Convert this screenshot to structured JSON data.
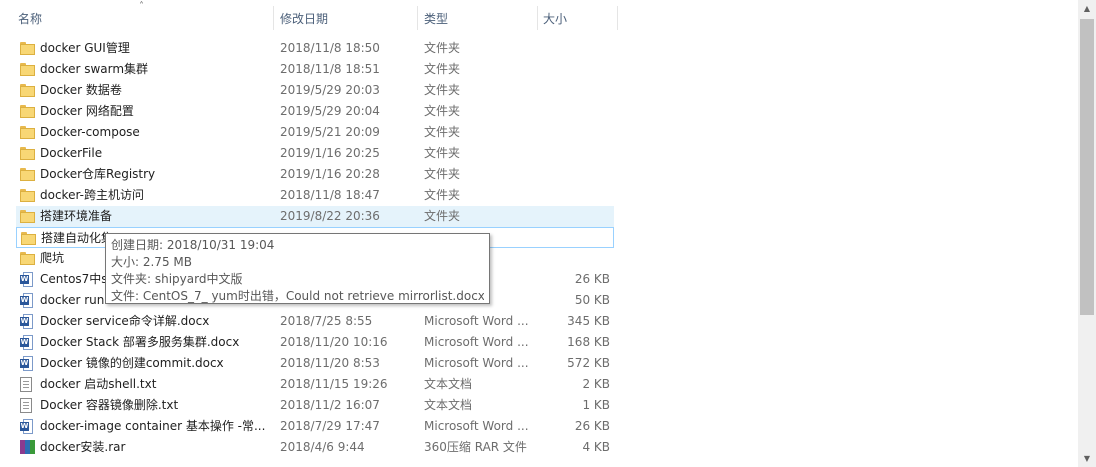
{
  "columns": {
    "name": "名称",
    "date": "修改日期",
    "type": "类型",
    "size": "大小"
  },
  "sort_indicator": "˄",
  "files": [
    {
      "name": "docker GUI管理",
      "date": "2018/11/8 18:50",
      "type": "文件夹",
      "size": "",
      "icon": "folder-icon"
    },
    {
      "name": "docker swarm集群",
      "date": "2018/11/8 18:51",
      "type": "文件夹",
      "size": "",
      "icon": "folder-icon"
    },
    {
      "name": "Docker 数据卷",
      "date": "2019/5/29 20:03",
      "type": "文件夹",
      "size": "",
      "icon": "folder-icon"
    },
    {
      "name": "Docker 网络配置",
      "date": "2019/5/29 20:04",
      "type": "文件夹",
      "size": "",
      "icon": "folder-icon"
    },
    {
      "name": "Docker-compose",
      "date": "2019/5/21 20:09",
      "type": "文件夹",
      "size": "",
      "icon": "folder-icon"
    },
    {
      "name": "DockerFile",
      "date": "2019/1/16 20:25",
      "type": "文件夹",
      "size": "",
      "icon": "folder-icon"
    },
    {
      "name": "Docker仓库Registry",
      "date": "2019/1/16 20:28",
      "type": "文件夹",
      "size": "",
      "icon": "folder-icon"
    },
    {
      "name": "docker-跨主机访问",
      "date": "2018/11/8 18:47",
      "type": "文件夹",
      "size": "",
      "icon": "folder-icon"
    },
    {
      "name": "搭建环境准备",
      "date": "2019/8/22 20:36",
      "type": "文件夹",
      "size": "",
      "icon": "folder-icon"
    },
    {
      "name": "搭建自动化集",
      "date": "",
      "type": "",
      "size": "",
      "icon": "folder-icon"
    },
    {
      "name": "爬坑",
      "date": "",
      "type": "",
      "size": "",
      "icon": "folder-icon"
    },
    {
      "name": "Centos7中s",
      "date": "",
      "type": "Word ...",
      "size": "26 KB",
      "icon": "word-doc-icon"
    },
    {
      "name": "docker run",
      "date": "",
      "type": "Word ...",
      "size": "50 KB",
      "icon": "word-doc-icon"
    },
    {
      "name": "Docker service命令详解.docx",
      "date": "2018/7/25 8:55",
      "type": "Microsoft Word ...",
      "size": "345 KB",
      "icon": "word-doc-icon"
    },
    {
      "name": "Docker Stack 部署多服务集群.docx",
      "date": "2018/11/20 10:16",
      "type": "Microsoft Word ...",
      "size": "168 KB",
      "icon": "word-doc-icon"
    },
    {
      "name": "Docker 镜像的创建commit.docx",
      "date": "2018/11/20 8:53",
      "type": "Microsoft Word ...",
      "size": "572 KB",
      "icon": "word-doc-icon"
    },
    {
      "name": "docker 启动shell.txt",
      "date": "2018/11/15 19:26",
      "type": "文本文档",
      "size": "2 KB",
      "icon": "text-file-icon"
    },
    {
      "name": "Docker 容器镜像删除.txt",
      "date": "2018/11/2 16:07",
      "type": "文本文档",
      "size": "1 KB",
      "icon": "text-file-icon"
    },
    {
      "name": "docker-image container 基本操作 -常...",
      "date": "2018/7/29 17:47",
      "type": "Microsoft Word ...",
      "size": "26 KB",
      "icon": "word-doc-icon"
    },
    {
      "name": "docker安装.rar",
      "date": "2018/4/6 9:44",
      "type": "360压缩 RAR 文件",
      "size": "4 KB",
      "icon": "rar-archive-icon"
    }
  ],
  "tooltip": {
    "created": "创建日期: 2018/10/31 19:04",
    "size": "大小: 2.75 MB",
    "folders": "文件夹: shipyard中文版",
    "files": "文件: CentOS_7_ yum时出错，Could not retrieve mirrorlist.docx, ..."
  },
  "scrollbar": {
    "up_arrow": "▲",
    "down_arrow": "▼"
  }
}
